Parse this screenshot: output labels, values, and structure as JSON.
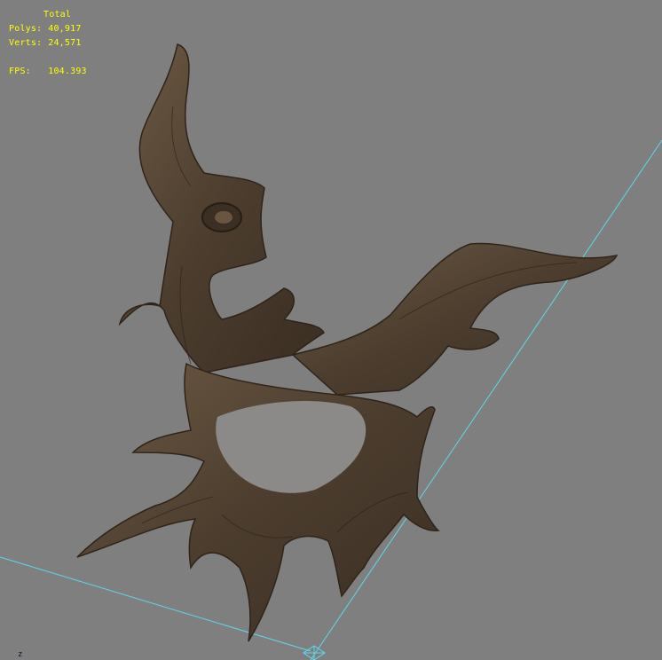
{
  "stats": {
    "title": "Total",
    "polys_label": "Polys:",
    "polys_value": "40,917",
    "verts_label": "Verts:",
    "verts_value": "24,571",
    "fps_label": "FPS:",
    "fps_value": "104.393"
  },
  "axis": {
    "label": "z"
  },
  "colors": {
    "background": "#7f7f7f",
    "stats_text": "#ffff00",
    "grid_line": "#5fd7ef",
    "wood_dark": "#3a2e22",
    "wood_light": "#7a6650"
  },
  "icons": {
    "gizmo": "perspective-gizmo-icon"
  }
}
